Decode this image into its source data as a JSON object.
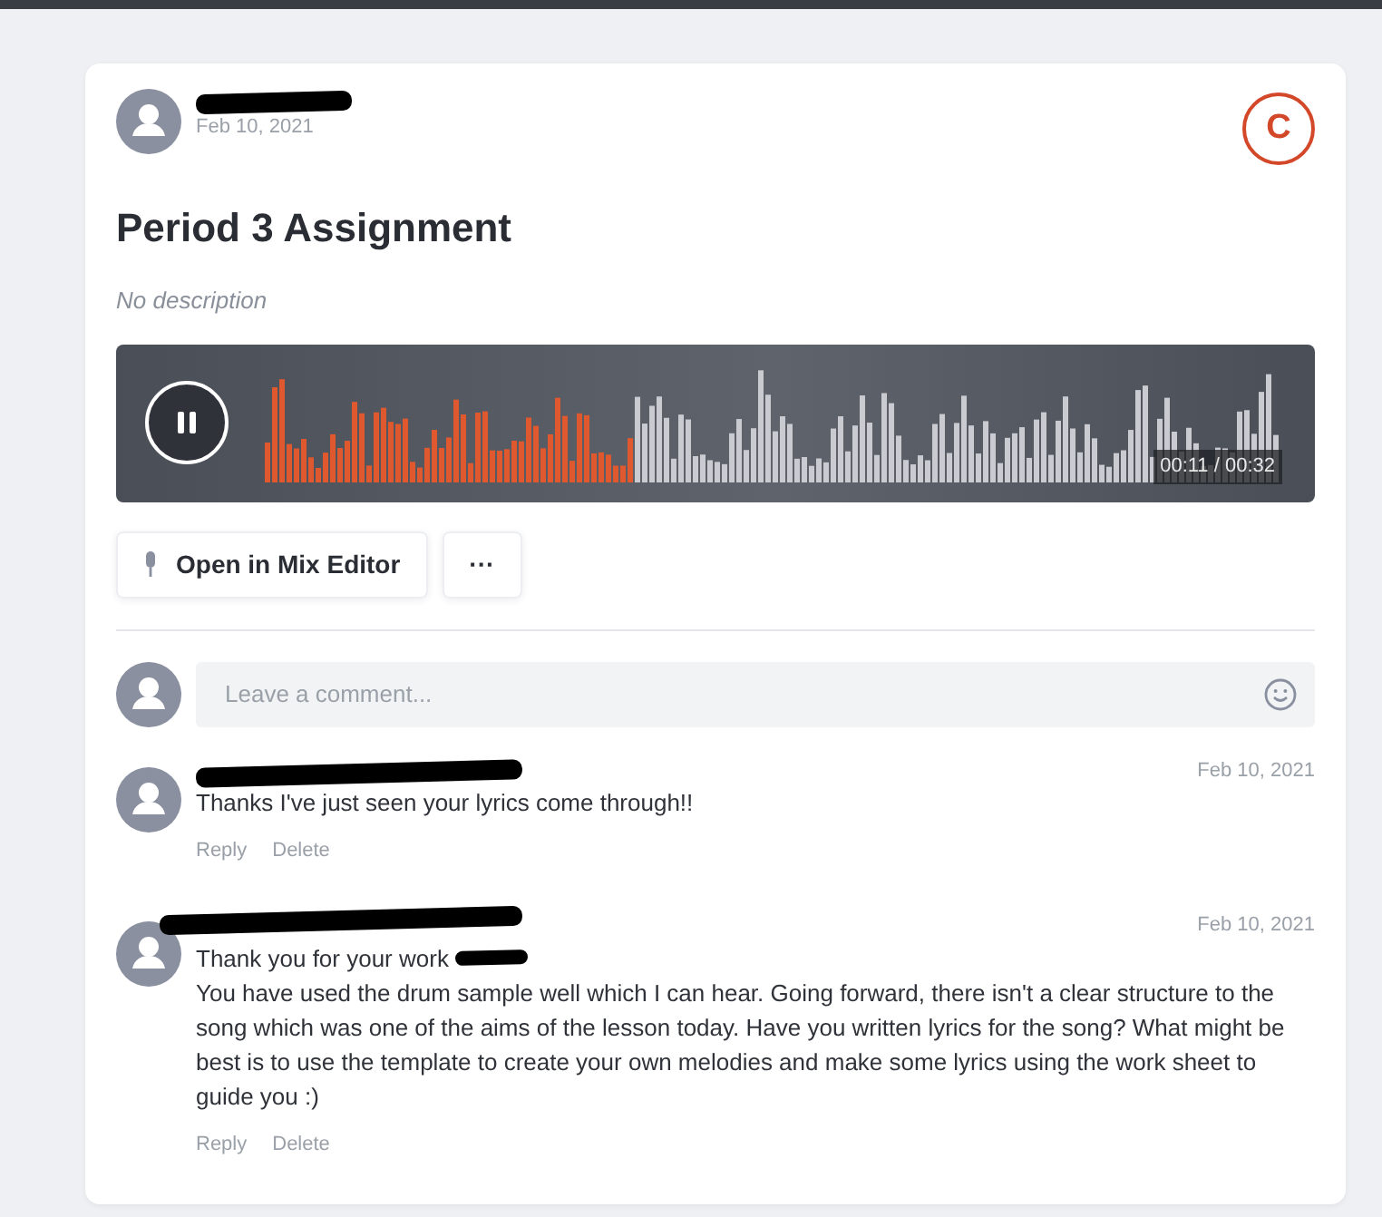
{
  "post": {
    "date": "Feb 10, 2021",
    "badge": "C",
    "title": "Period 3 Assignment",
    "description": "No description"
  },
  "player": {
    "playing": true,
    "time": "00:11 / 00:32"
  },
  "actions": [
    {
      "kind": "mic",
      "label": "Open in Mix Editor"
    },
    {
      "kind": "more",
      "label": "···"
    }
  ],
  "comment_box": {
    "placeholder": "Leave a comment..."
  },
  "comments": [
    {
      "date": "Feb 10, 2021",
      "parts": [
        {
          "kind": "text",
          "text": "Thanks I've just seen your lyrics come through!!"
        }
      ],
      "actions": [
        "Reply",
        "Delete"
      ]
    },
    {
      "date": "Feb 10, 2021",
      "parts": [
        {
          "kind": "text",
          "text": "Thank you for your work"
        },
        {
          "kind": "redacted"
        },
        {
          "kind": "text",
          "text": "You have used the drum sample well which I can hear. Going forward, there isn't a clear structure to the song which was one of the aims of the lesson today. Have you written lyrics for the song? What might be best is to use the template to create your own melodies and make some lyrics using the work sheet to guide you :)"
        }
      ],
      "actions": [
        "Reply",
        "Delete"
      ]
    }
  ]
}
